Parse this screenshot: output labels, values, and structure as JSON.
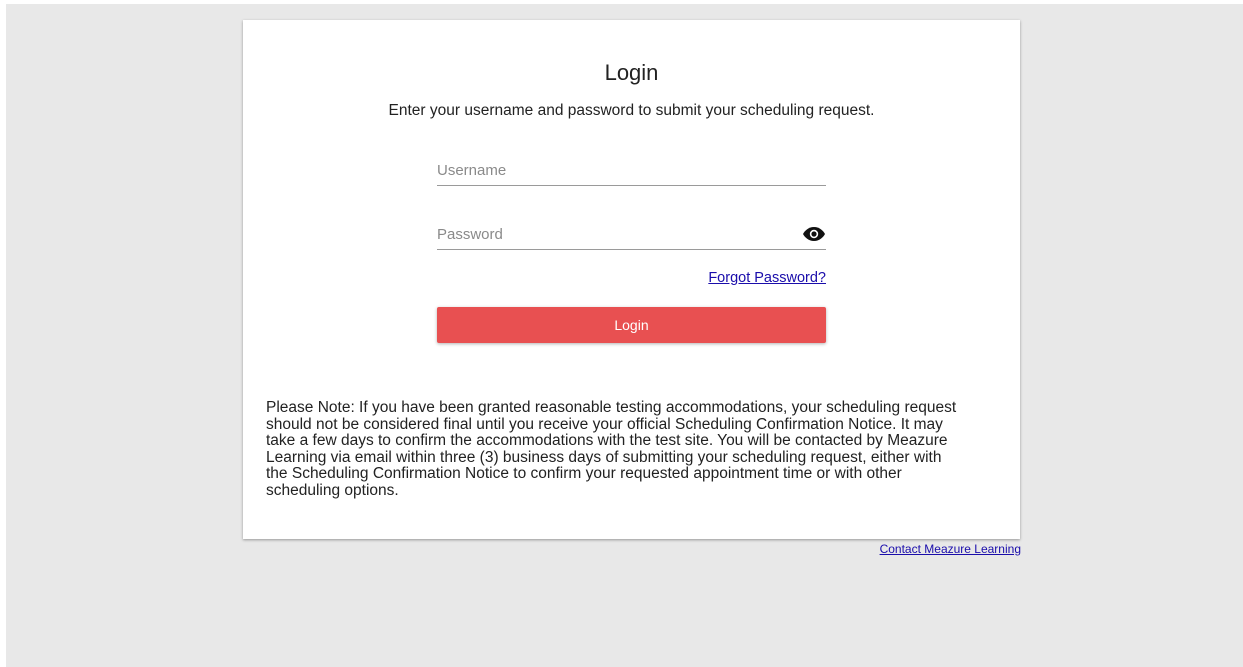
{
  "login": {
    "title": "Login",
    "subtitle": "Enter your username and password to submit your scheduling request.",
    "username_placeholder": "Username",
    "username_value": "",
    "password_placeholder": "Password",
    "password_value": "",
    "password_toggle_icon": "eye-icon",
    "forgot_password_label": "Forgot Password?",
    "login_button_label": "Login",
    "note": "Please Note: If you have been granted reasonable testing accommodations, your scheduling request should not be considered final until you receive your official Scheduling Confirmation Notice. It may take a few days to confirm the accommodations with the test site. You will be contacted by Meazure Learning via email within three (3) business days of submitting your scheduling request, either with the Scheduling Confirmation Notice to confirm your requested appointment time or with other scheduling options."
  },
  "footer": {
    "contact_label": "Contact Meazure Learning"
  },
  "colors": {
    "page_background": "#e8e8e8",
    "card_background": "#ffffff",
    "button_accent": "#e85051",
    "link": "#1a0dab"
  }
}
